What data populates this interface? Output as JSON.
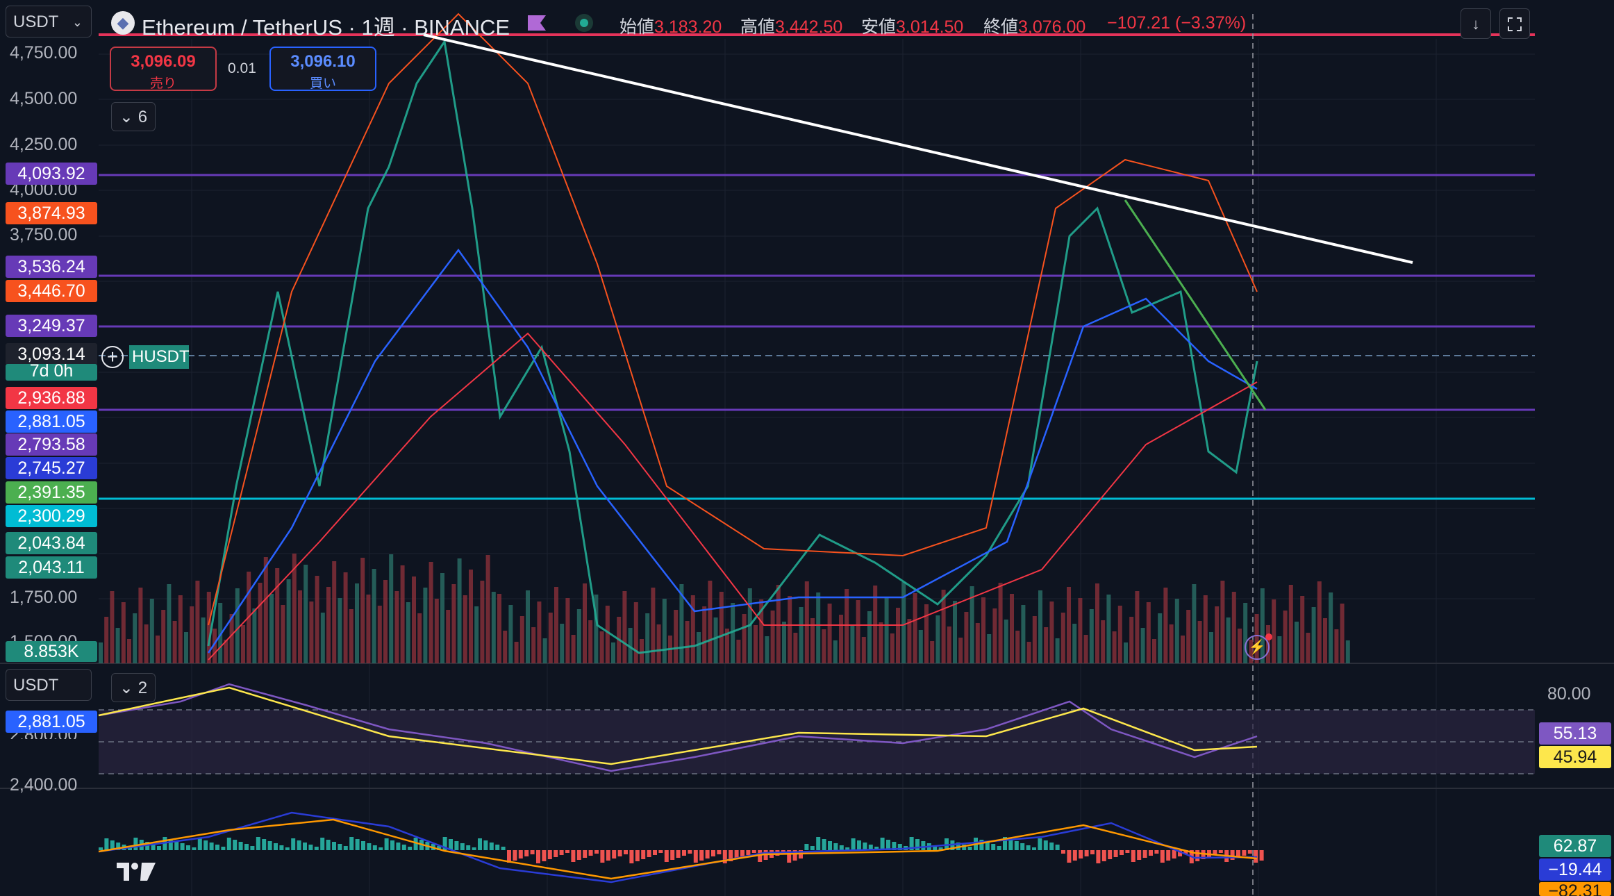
{
  "symbol_select": {
    "label": "USDT"
  },
  "header": {
    "title": "Ethereum / TetherUS · 1週 · BINANCE",
    "ohlc": [
      {
        "key": "始値",
        "value": "3,183.20"
      },
      {
        "key": "高値",
        "value": "3,442.50"
      },
      {
        "key": "安値",
        "value": "3,014.50"
      },
      {
        "key": "終値",
        "value": "3,076.00"
      }
    ],
    "change": "−107.21 (−3.37%)"
  },
  "trade": {
    "sell_price": "3,096.09",
    "sell_label": "売り",
    "spread": "0.01",
    "buy_price": "3,096.10",
    "buy_label": "買い"
  },
  "indicators_toggle": {
    "count": "6"
  },
  "sub_indicators_toggle": {
    "count": "2"
  },
  "axis_ticks": [
    "4,750.00",
    "4,500.00",
    "4,250.00",
    "4,000.00",
    "3,750.00",
    "1,750.00",
    "1,500.00"
  ],
  "price_tags": [
    {
      "label": "4,093.92",
      "color": "#673ab7"
    },
    {
      "label": "3,874.93",
      "color": "#f7521e"
    },
    {
      "label": "3,536.24",
      "color": "#673ab7"
    },
    {
      "label": "3,446.70",
      "color": "#f7521e"
    },
    {
      "label": "3,249.37",
      "color": "#673ab7"
    },
    {
      "label": "3,093.14",
      "color": "#1e222d"
    },
    {
      "label": "7d 0h",
      "color": "#1f8a7a"
    },
    {
      "label": "2,936.88",
      "color": "#f23645"
    },
    {
      "label": "2,881.05",
      "color": "#2962ff"
    },
    {
      "label": "2,793.58",
      "color": "#673ab7"
    },
    {
      "label": "2,745.27",
      "color": "#2a3cd6"
    },
    {
      "label": "2,391.35",
      "color": "#4caf50"
    },
    {
      "label": "2,300.29",
      "color": "#00bcd4"
    },
    {
      "label": "2,043.84",
      "color": "#1f8a7a"
    },
    {
      "label": "2,043.11",
      "color": "#1f8a7a"
    },
    {
      "label": "8.853K",
      "color": "#1f8a7a"
    }
  ],
  "current_symbol_tag": "HUSDT",
  "lower_pane": {
    "currency_select": "USDT",
    "price_tag": "2,881.05",
    "axis_partial": "2,800.00",
    "axis_bottom": "2,400.00"
  },
  "rsi": {
    "level_80": "80.00",
    "value": "55.13",
    "signal": "45.94"
  },
  "macd": {
    "hist": "62.87",
    "macd": "−19.44",
    "signal": "−82.31"
  },
  "colors": {
    "bg": "#0e1420",
    "up": "#22ab94",
    "down": "#f23645",
    "trendline": "#ffffff",
    "support": "#00bcd4",
    "resistance": "#673ab7"
  },
  "icons": [
    "chevron-down-icon",
    "ethereum-icon",
    "flag-icon",
    "market-status-icon",
    "download-icon",
    "fullscreen-icon",
    "plus-icon",
    "lightning-icon",
    "tradingview-logo"
  ]
}
